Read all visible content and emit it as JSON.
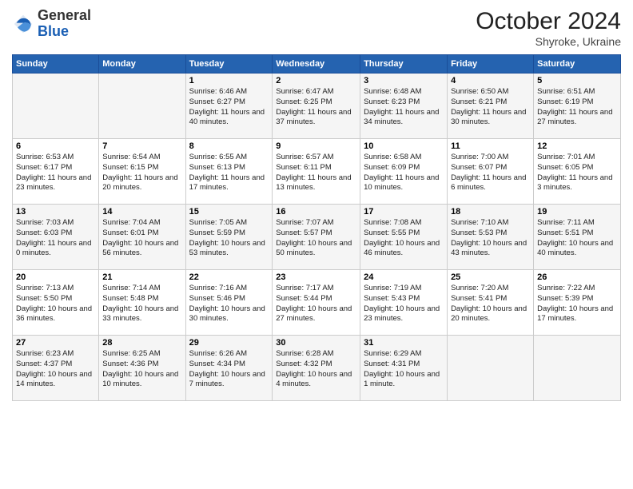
{
  "header": {
    "logo_general": "General",
    "logo_blue": "Blue",
    "month_title": "October 2024",
    "subtitle": "Shyroke, Ukraine"
  },
  "weekdays": [
    "Sunday",
    "Monday",
    "Tuesday",
    "Wednesday",
    "Thursday",
    "Friday",
    "Saturday"
  ],
  "weeks": [
    [
      {
        "day": "",
        "info": ""
      },
      {
        "day": "",
        "info": ""
      },
      {
        "day": "1",
        "info": "Sunrise: 6:46 AM\nSunset: 6:27 PM\nDaylight: 11 hours and 40 minutes."
      },
      {
        "day": "2",
        "info": "Sunrise: 6:47 AM\nSunset: 6:25 PM\nDaylight: 11 hours and 37 minutes."
      },
      {
        "day": "3",
        "info": "Sunrise: 6:48 AM\nSunset: 6:23 PM\nDaylight: 11 hours and 34 minutes."
      },
      {
        "day": "4",
        "info": "Sunrise: 6:50 AM\nSunset: 6:21 PM\nDaylight: 11 hours and 30 minutes."
      },
      {
        "day": "5",
        "info": "Sunrise: 6:51 AM\nSunset: 6:19 PM\nDaylight: 11 hours and 27 minutes."
      }
    ],
    [
      {
        "day": "6",
        "info": "Sunrise: 6:53 AM\nSunset: 6:17 PM\nDaylight: 11 hours and 23 minutes."
      },
      {
        "day": "7",
        "info": "Sunrise: 6:54 AM\nSunset: 6:15 PM\nDaylight: 11 hours and 20 minutes."
      },
      {
        "day": "8",
        "info": "Sunrise: 6:55 AM\nSunset: 6:13 PM\nDaylight: 11 hours and 17 minutes."
      },
      {
        "day": "9",
        "info": "Sunrise: 6:57 AM\nSunset: 6:11 PM\nDaylight: 11 hours and 13 minutes."
      },
      {
        "day": "10",
        "info": "Sunrise: 6:58 AM\nSunset: 6:09 PM\nDaylight: 11 hours and 10 minutes."
      },
      {
        "day": "11",
        "info": "Sunrise: 7:00 AM\nSunset: 6:07 PM\nDaylight: 11 hours and 6 minutes."
      },
      {
        "day": "12",
        "info": "Sunrise: 7:01 AM\nSunset: 6:05 PM\nDaylight: 11 hours and 3 minutes."
      }
    ],
    [
      {
        "day": "13",
        "info": "Sunrise: 7:03 AM\nSunset: 6:03 PM\nDaylight: 11 hours and 0 minutes."
      },
      {
        "day": "14",
        "info": "Sunrise: 7:04 AM\nSunset: 6:01 PM\nDaylight: 10 hours and 56 minutes."
      },
      {
        "day": "15",
        "info": "Sunrise: 7:05 AM\nSunset: 5:59 PM\nDaylight: 10 hours and 53 minutes."
      },
      {
        "day": "16",
        "info": "Sunrise: 7:07 AM\nSunset: 5:57 PM\nDaylight: 10 hours and 50 minutes."
      },
      {
        "day": "17",
        "info": "Sunrise: 7:08 AM\nSunset: 5:55 PM\nDaylight: 10 hours and 46 minutes."
      },
      {
        "day": "18",
        "info": "Sunrise: 7:10 AM\nSunset: 5:53 PM\nDaylight: 10 hours and 43 minutes."
      },
      {
        "day": "19",
        "info": "Sunrise: 7:11 AM\nSunset: 5:51 PM\nDaylight: 10 hours and 40 minutes."
      }
    ],
    [
      {
        "day": "20",
        "info": "Sunrise: 7:13 AM\nSunset: 5:50 PM\nDaylight: 10 hours and 36 minutes."
      },
      {
        "day": "21",
        "info": "Sunrise: 7:14 AM\nSunset: 5:48 PM\nDaylight: 10 hours and 33 minutes."
      },
      {
        "day": "22",
        "info": "Sunrise: 7:16 AM\nSunset: 5:46 PM\nDaylight: 10 hours and 30 minutes."
      },
      {
        "day": "23",
        "info": "Sunrise: 7:17 AM\nSunset: 5:44 PM\nDaylight: 10 hours and 27 minutes."
      },
      {
        "day": "24",
        "info": "Sunrise: 7:19 AM\nSunset: 5:43 PM\nDaylight: 10 hours and 23 minutes."
      },
      {
        "day": "25",
        "info": "Sunrise: 7:20 AM\nSunset: 5:41 PM\nDaylight: 10 hours and 20 minutes."
      },
      {
        "day": "26",
        "info": "Sunrise: 7:22 AM\nSunset: 5:39 PM\nDaylight: 10 hours and 17 minutes."
      }
    ],
    [
      {
        "day": "27",
        "info": "Sunrise: 6:23 AM\nSunset: 4:37 PM\nDaylight: 10 hours and 14 minutes."
      },
      {
        "day": "28",
        "info": "Sunrise: 6:25 AM\nSunset: 4:36 PM\nDaylight: 10 hours and 10 minutes."
      },
      {
        "day": "29",
        "info": "Sunrise: 6:26 AM\nSunset: 4:34 PM\nDaylight: 10 hours and 7 minutes."
      },
      {
        "day": "30",
        "info": "Sunrise: 6:28 AM\nSunset: 4:32 PM\nDaylight: 10 hours and 4 minutes."
      },
      {
        "day": "31",
        "info": "Sunrise: 6:29 AM\nSunset: 4:31 PM\nDaylight: 10 hours and 1 minute."
      },
      {
        "day": "",
        "info": ""
      },
      {
        "day": "",
        "info": ""
      }
    ]
  ]
}
